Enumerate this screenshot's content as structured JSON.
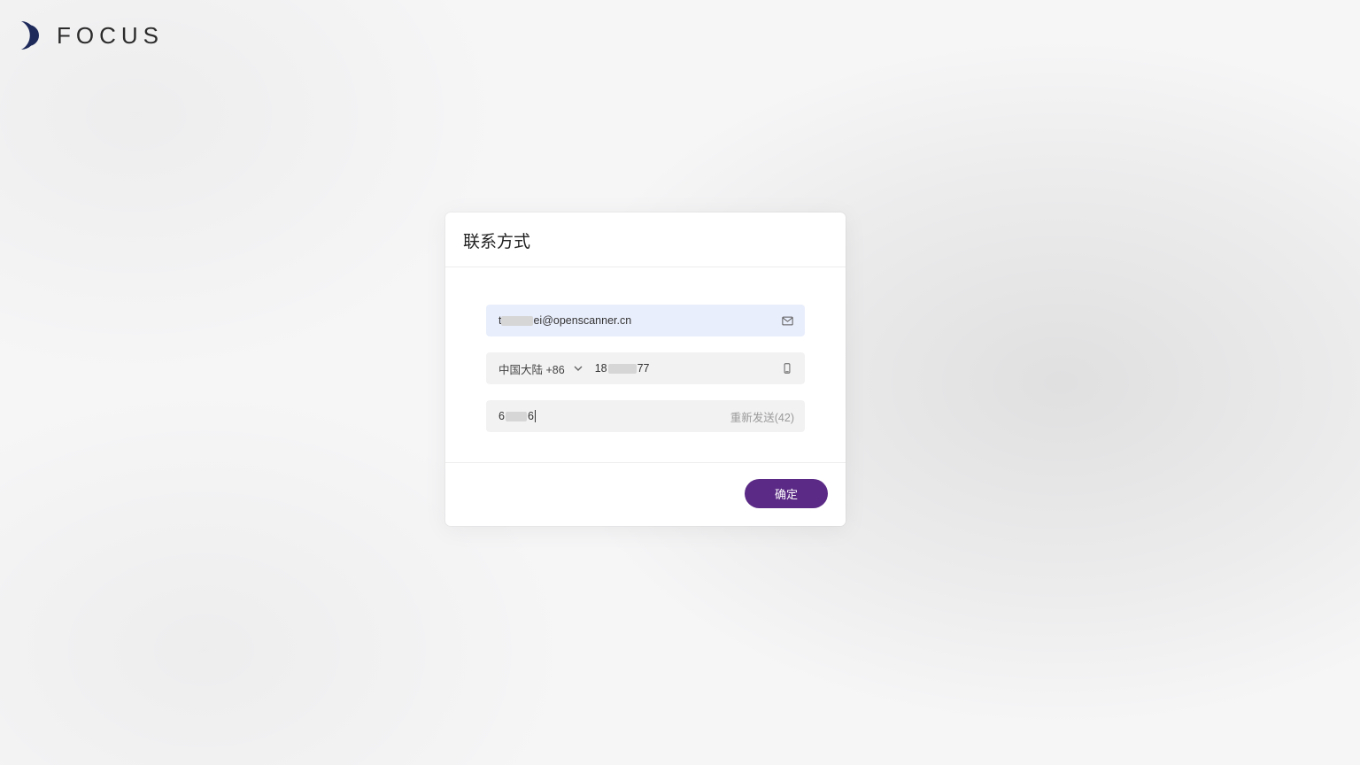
{
  "brand": {
    "name": "FOCUS"
  },
  "card": {
    "title": "联系方式",
    "email": {
      "prefix_masked": "t",
      "suffix": "ei@openscanner.cn"
    },
    "phone": {
      "country_label": "中国大陆 +86",
      "prefix": "18",
      "suffix": "77"
    },
    "code": {
      "prefix": "6",
      "suffix": "6",
      "resend_label": "重新发送(42)"
    },
    "confirm_label": "确定"
  }
}
